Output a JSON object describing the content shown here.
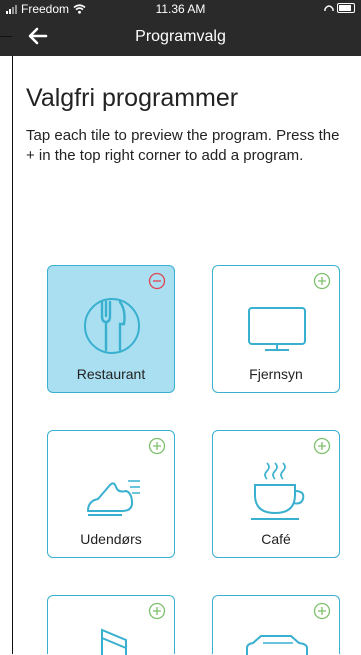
{
  "status_bar": {
    "carrier": "Freedom",
    "time": "11.36 AM"
  },
  "nav": {
    "title": "Programvalg"
  },
  "page": {
    "title": "Valgfri programmer",
    "intro": "Tap each tile to preview the program. Press the + in the top right corner to add a program."
  },
  "tiles": [
    {
      "label": "Restaurant",
      "icon": "cutlery-icon",
      "badge": "remove-icon",
      "selected": true
    },
    {
      "label": "Fjernsyn",
      "icon": "tv-icon",
      "badge": "add-icon",
      "selected": false
    },
    {
      "label": "Udendørs",
      "icon": "running-shoe-icon",
      "badge": "add-icon",
      "selected": false
    },
    {
      "label": "Café",
      "icon": "coffee-cup-icon",
      "badge": "add-icon",
      "selected": false
    },
    {
      "label": "",
      "icon": "music-note-icon",
      "badge": "add-icon",
      "selected": false
    },
    {
      "label": "",
      "icon": "car-icon",
      "badge": "add-icon",
      "selected": false
    }
  ],
  "colors": {
    "accent": "#39b0cf",
    "selected_fill": "#a9dff1",
    "remove": "#e0434f",
    "add": "#7cc06b",
    "bar": "#2a2a2a"
  }
}
